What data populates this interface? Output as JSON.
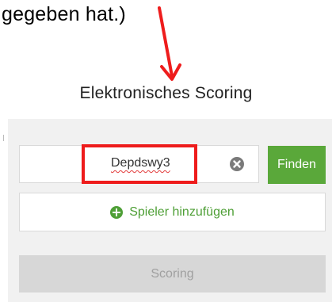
{
  "caption": {
    "text": "gegeben hat.)"
  },
  "page": {
    "title": "Elektronisches Scoring"
  },
  "search": {
    "value": "Depdswy3",
    "clear_icon": "clear-circle-x-icon"
  },
  "buttons": {
    "find_label": "Finden",
    "add_player_label": "Spieler hinzufügen",
    "add_player_icon": "plus-circle-icon",
    "scoring_label": "Scoring"
  },
  "colors": {
    "accent_green": "#5aa83a",
    "annotation_red": "#ee1c1c",
    "disabled_gray": "#d7d7d7"
  }
}
